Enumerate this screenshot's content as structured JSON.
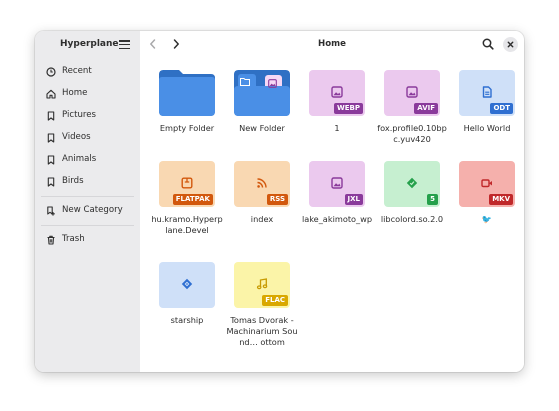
{
  "app": {
    "title": "Hyperplane"
  },
  "header": {
    "location": "Home"
  },
  "sidebar": {
    "items": [
      {
        "label": "Recent",
        "icon": "clock-icon"
      },
      {
        "label": "Home",
        "icon": "home-icon"
      },
      {
        "label": "Pictures",
        "icon": "bookmark-icon"
      },
      {
        "label": "Videos",
        "icon": "bookmark-icon"
      },
      {
        "label": "Animals",
        "icon": "bookmark-icon"
      },
      {
        "label": "Birds",
        "icon": "bookmark-icon"
      }
    ],
    "new_category": {
      "label": "New Category",
      "icon": "tag-add-icon"
    },
    "trash": {
      "label": "Trash",
      "icon": "trash-icon"
    }
  },
  "files": [
    {
      "name": "Empty Folder",
      "kind": "folder"
    },
    {
      "name": "New Folder",
      "kind": "folder-thumbs"
    },
    {
      "name": "1",
      "kind": "file",
      "badge": "WEBP",
      "icon": "image-icon",
      "tile_color": "#ebc9ee",
      "badge_color": "#8a3a9b"
    },
    {
      "name": "fox.profile0.10bpc.yuv420",
      "kind": "file",
      "badge": "AVIF",
      "icon": "image-icon",
      "tile_color": "#ebc9ee",
      "badge_color": "#8a3a9b"
    },
    {
      "name": "Hello World",
      "kind": "file",
      "badge": "ODT",
      "icon": "document-icon",
      "tile_color": "#cfe0f8",
      "badge_color": "#2f6fd1"
    },
    {
      "name": "hu.kramo.Hyperplane.Devel",
      "kind": "file",
      "badge": "FLATPAK",
      "icon": "package-icon",
      "tile_color": "#f9d8b2",
      "badge_color": "#d2580d"
    },
    {
      "name": "index",
      "kind": "file",
      "badge": "RSS",
      "icon": "rss-icon",
      "tile_color": "#f9d8b2",
      "badge_color": "#d2580d"
    },
    {
      "name": "lake_akimoto_wp",
      "kind": "file",
      "badge": "JXL",
      "icon": "image-icon",
      "tile_color": "#ebc9ee",
      "badge_color": "#8a3a9b"
    },
    {
      "name": "libcolord.so.2.0",
      "kind": "file",
      "badge": "5",
      "icon": "library-icon",
      "tile_color": "#c6efd0",
      "badge_color": "#25a04b"
    },
    {
      "name": "🐦",
      "kind": "file",
      "badge": "MKV",
      "icon": "video-icon",
      "tile_color": "#f5b0ac",
      "badge_color": "#c0282a"
    },
    {
      "name": "starship",
      "kind": "file",
      "badge": "",
      "icon": "diamond-icon",
      "tile_color": "#cfe0f8",
      "badge_color": "#2f6fd1"
    },
    {
      "name": "Tomas Dvorak - Machinarium Sound… ottom",
      "kind": "file",
      "badge": "FLAC",
      "icon": "music-icon",
      "tile_color": "#fbf4a8",
      "badge_color": "#d9a800"
    }
  ],
  "colors": {
    "accent": "#3584e4",
    "folder": "#438de6",
    "folder_tab": "#2f70c4"
  }
}
